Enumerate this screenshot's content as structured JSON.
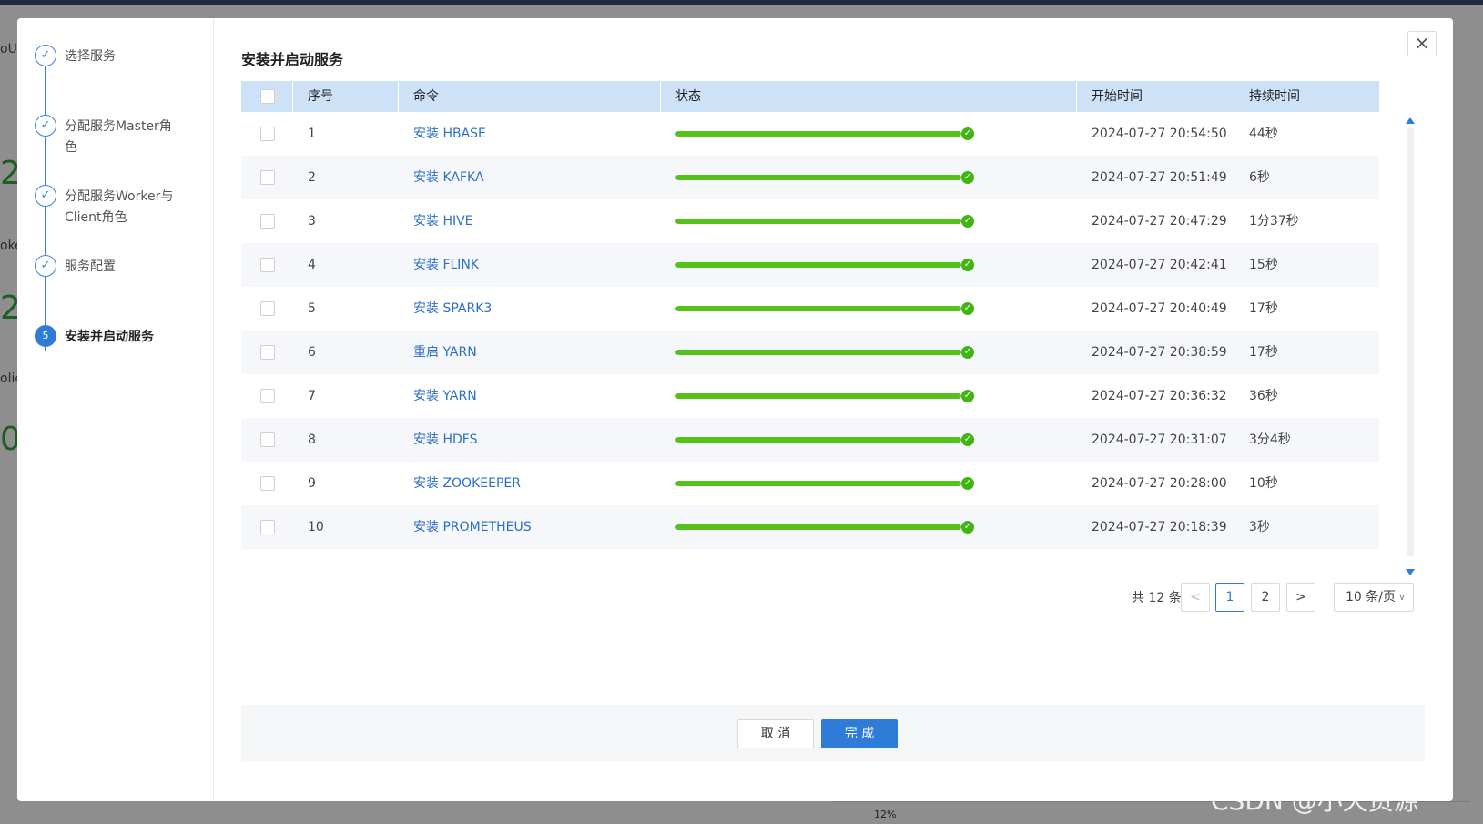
{
  "background": {
    "fragments": [
      "oUI",
      "oke",
      "olic"
    ],
    "big_digits": [
      "2",
      "2",
      "0"
    ],
    "percent_label": "12%"
  },
  "dialog": {
    "close_glyph": "×",
    "steps": [
      {
        "label": "选择服务",
        "status": "done",
        "dot": "✓"
      },
      {
        "label": "分配服务Master角色",
        "status": "done",
        "dot": "✓"
      },
      {
        "label": "分配服务Worker与Client角色",
        "status": "done",
        "dot": "✓"
      },
      {
        "label": "服务配置",
        "status": "done",
        "dot": "✓"
      },
      {
        "label": "安装并启动服务",
        "status": "active",
        "dot": "5"
      }
    ],
    "title": "安装并启动服务",
    "table": {
      "columns": [
        "序号",
        "命令",
        "状态",
        "开始时间",
        "持续时间"
      ],
      "rows": [
        {
          "index": "1",
          "command": "安装 HBASE",
          "progress": 1.0,
          "start": "2024-07-27 20:54:50",
          "duration": "44秒"
        },
        {
          "index": "2",
          "command": "安装 KAFKA",
          "progress": 1.0,
          "start": "2024-07-27 20:51:49",
          "duration": "6秒"
        },
        {
          "index": "3",
          "command": "安装 HIVE",
          "progress": 1.0,
          "start": "2024-07-27 20:47:29",
          "duration": "1分37秒"
        },
        {
          "index": "4",
          "command": "安装 FLINK",
          "progress": 1.0,
          "start": "2024-07-27 20:42:41",
          "duration": "15秒"
        },
        {
          "index": "5",
          "command": "安装 SPARK3",
          "progress": 1.0,
          "start": "2024-07-27 20:40:49",
          "duration": "17秒"
        },
        {
          "index": "6",
          "command": "重启 YARN",
          "progress": 1.0,
          "start": "2024-07-27 20:38:59",
          "duration": "17秒"
        },
        {
          "index": "7",
          "command": "安装 YARN",
          "progress": 1.0,
          "start": "2024-07-27 20:36:32",
          "duration": "36秒"
        },
        {
          "index": "8",
          "command": "安装 HDFS",
          "progress": 1.0,
          "start": "2024-07-27 20:31:07",
          "duration": "3分4秒"
        },
        {
          "index": "9",
          "command": "安装 ZOOKEEPER",
          "progress": 1.0,
          "start": "2024-07-27 20:28:00",
          "duration": "10秒"
        },
        {
          "index": "10",
          "command": "安装 PROMETHEUS",
          "progress": 1.0,
          "start": "2024-07-27 20:18:39",
          "duration": "3秒"
        }
      ]
    },
    "pagination": {
      "total": "共 12 条",
      "prev": "<",
      "pages": [
        "1",
        "2"
      ],
      "current": "1",
      "next": ">",
      "page_size": "10 条/页",
      "page_size_chevron": "∨"
    },
    "footer": {
      "cancel": "取 消",
      "done": "完 成"
    }
  },
  "watermark": "CSDN @小天资源",
  "colors": {
    "accent": "#2f7bd8",
    "progress": "#55c21a",
    "success": "#3fb512",
    "header_bg": "#cde1f7"
  }
}
